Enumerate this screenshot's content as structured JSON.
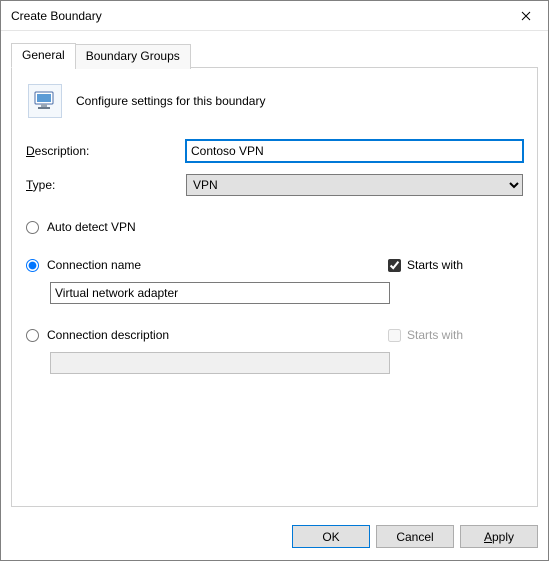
{
  "window": {
    "title": "Create Boundary"
  },
  "tabs": {
    "general": "General",
    "boundary_groups": "Boundary Groups"
  },
  "header_text": "Configure settings for this boundary",
  "labels": {
    "description": "Description:",
    "type": "Type:"
  },
  "fields": {
    "description_value": "Contoso VPN",
    "type_value": "VPN"
  },
  "vpn": {
    "auto_detect": "Auto detect VPN",
    "conn_name": "Connection name",
    "conn_name_value": "Virtual network adapter",
    "conn_name_starts_with": "Starts with",
    "conn_desc": "Connection description",
    "conn_desc_value": "",
    "conn_desc_starts_with": "Starts with"
  },
  "buttons": {
    "ok": "OK",
    "cancel": "Cancel",
    "apply": "Apply"
  }
}
